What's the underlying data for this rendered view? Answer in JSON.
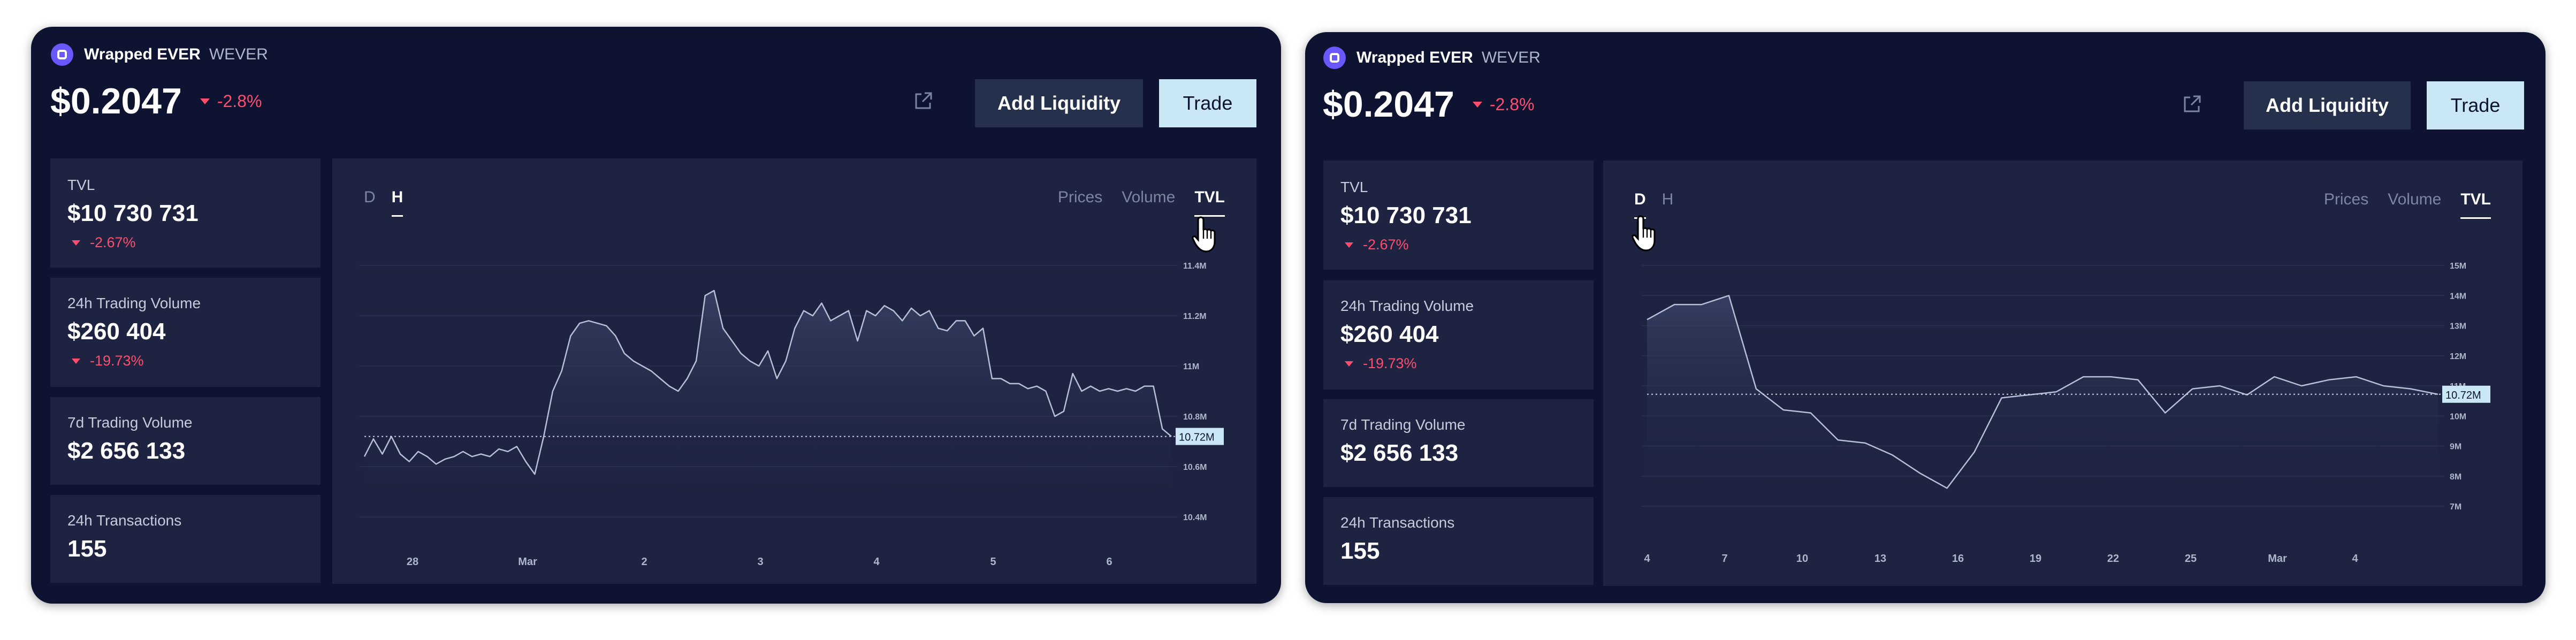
{
  "token": {
    "name": "Wrapped EVER",
    "symbol": "WEVER"
  },
  "price": "$0.2047",
  "price_change": "-2.8%",
  "buttons": {
    "add_liquidity": "Add Liquidity",
    "trade": "Trade"
  },
  "stats": [
    {
      "label": "TVL",
      "value": "$10 730 731",
      "change": "-2.67%"
    },
    {
      "label": "24h Trading Volume",
      "value": "$260 404",
      "change": "-19.73%"
    },
    {
      "label": "7d Trading Volume",
      "value": "$2 656 133"
    },
    {
      "label": "24h Transactions",
      "value": "155"
    }
  ],
  "timeframe_tabs": [
    "D",
    "H"
  ],
  "metric_tabs": [
    "Prices",
    "Volume",
    "TVL"
  ],
  "colors": {
    "panel_bg": "#0d1330",
    "card_bg": "#1d2340",
    "negative": "#ff4d6d",
    "trade_button": "#c9e7f5",
    "add_button": "#24304c"
  },
  "icons": [
    "token-logo",
    "external-link-icon",
    "chevron-down-icon",
    "hand-cursor-icon"
  ],
  "chart_data": [
    {
      "type": "area",
      "metric": "TVL",
      "timeframe": "H",
      "x_tick_labels": [
        "28",
        "Mar",
        "2",
        "3",
        "4",
        "5",
        "6"
      ],
      "y_tick_labels": [
        "11.4M",
        "11.2M",
        "11M",
        "10.8M",
        "10.6M",
        "10.4M"
      ],
      "ylim": [
        10.4,
        11.4
      ],
      "current_value_label": "10.72M",
      "current_value": 10.72,
      "values": [
        10.64,
        10.71,
        10.65,
        10.72,
        10.65,
        10.62,
        10.66,
        10.64,
        10.61,
        10.63,
        10.64,
        10.66,
        10.64,
        10.65,
        10.64,
        10.67,
        10.66,
        10.68,
        10.62,
        10.57,
        10.72,
        10.9,
        10.98,
        11.12,
        11.17,
        11.18,
        11.17,
        11.16,
        11.12,
        11.05,
        11.02,
        11.0,
        10.98,
        10.95,
        10.92,
        10.9,
        10.95,
        11.02,
        11.28,
        11.3,
        11.15,
        11.1,
        11.05,
        11.02,
        11.0,
        11.06,
        10.95,
        11.02,
        11.15,
        11.22,
        11.2,
        11.25,
        11.18,
        11.2,
        11.22,
        11.1,
        11.22,
        11.2,
        11.24,
        11.22,
        11.18,
        11.23,
        11.2,
        11.22,
        11.15,
        11.14,
        11.18,
        11.18,
        11.12,
        11.15,
        10.95,
        10.95,
        10.93,
        10.93,
        10.91,
        10.92,
        10.9,
        10.8,
        10.82,
        10.97,
        10.9,
        10.92,
        10.9,
        10.91,
        10.9,
        10.91,
        10.9,
        10.92,
        10.92,
        10.75,
        10.72
      ]
    },
    {
      "type": "area",
      "metric": "TVL",
      "timeframe": "D",
      "x_tick_labels": [
        "4",
        "7",
        "10",
        "13",
        "16",
        "19",
        "22",
        "25",
        "Mar",
        "4"
      ],
      "y_tick_labels": [
        "15M",
        "14M",
        "13M",
        "12M",
        "11M",
        "10M",
        "9M",
        "8M",
        "7M"
      ],
      "ylim": [
        7,
        15
      ],
      "current_value_label": "10.72M",
      "current_value": 10.72,
      "values": [
        13.2,
        13.7,
        13.7,
        14.0,
        10.9,
        10.2,
        10.1,
        9.2,
        9.1,
        8.7,
        8.1,
        7.6,
        8.8,
        10.6,
        10.7,
        10.8,
        11.3,
        11.3,
        11.2,
        10.1,
        10.9,
        11.0,
        10.7,
        11.3,
        11.0,
        11.2,
        11.3,
        11.0,
        10.9,
        10.72
      ]
    }
  ]
}
